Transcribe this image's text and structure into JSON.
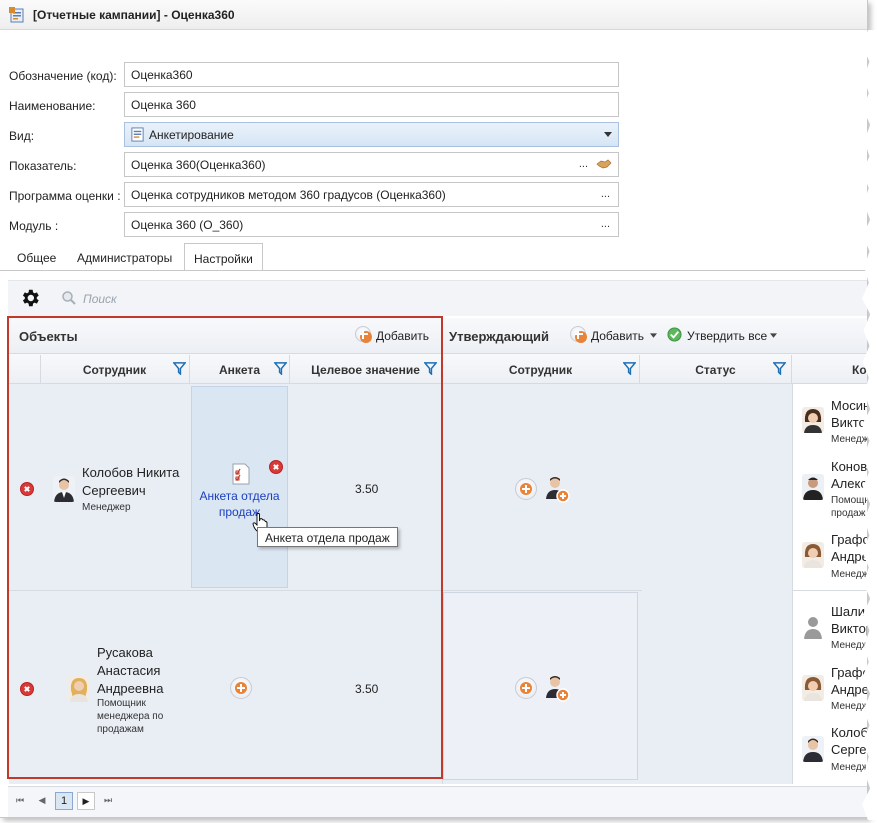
{
  "window": {
    "title": "[Отчетные кампании] - Оценка360"
  },
  "form": {
    "code_label": "Обозначение (код):",
    "code_value": "Оценка360",
    "name_label": "Наименование:",
    "name_value": "Оценка 360",
    "type_label": "Вид:",
    "type_value": "Анкетирование",
    "indicator_label": "Показатель:",
    "indicator_value": "Оценка 360(Оценка360)",
    "program_label": "Программа оценки :",
    "program_value": "Оценка сотрудников методом 360 градусов (Оценка360)",
    "module_label": "Модуль :",
    "module_value": "Оценка 360 (О_360)",
    "dots": "..."
  },
  "tabs": [
    {
      "label": "Общее"
    },
    {
      "label": "Администраторы"
    },
    {
      "label": "Настройки"
    }
  ],
  "toolbar": {
    "search_placeholder": "Поиск"
  },
  "objects": {
    "title": "Объекты",
    "add_label": "Добавить",
    "columns": [
      "Сотрудник",
      "Анкета",
      "Целевое значение"
    ]
  },
  "approver": {
    "title": "Утверждающий",
    "add_label": "Добавить",
    "approve_all_label": "Утвердить все",
    "columns": [
      "Сотрудник",
      "Статус"
    ]
  },
  "right_header": "Ко",
  "rows": [
    {
      "name": "Колобов Никита Сергеевич",
      "role": "Менеджер",
      "survey": "Анкета отдела продаж",
      "target": "3.50"
    },
    {
      "name": "Русакова Анастасия Андреевна",
      "role": "Помощник менеджера по продажам",
      "target": "3.50"
    }
  ],
  "tooltip": "Анкета отдела продаж",
  "right_people": [
    {
      "l1": "Мосин",
      "l2": "Виктор",
      "role": "Менедж"
    },
    {
      "l1": "Конов",
      "l2": "Алекса",
      "role": "Помощн",
      "role2": "продаж"
    },
    {
      "l1": "Графо",
      "l2": "Андре",
      "role": "Менедж"
    },
    {
      "l1": "Шалин",
      "l2": "Виктор",
      "role": "Менедж"
    },
    {
      "l1": "Графо",
      "l2": "Андре",
      "role": "Менедж"
    },
    {
      "l1": "Колоб",
      "l2": "Серге",
      "role": "Менедж"
    }
  ],
  "pager": {
    "page": "1"
  },
  "colors": {
    "accent_orange": "#e8833a",
    "remove_red": "#d83a3a",
    "frame_red": "#c0392b",
    "link_blue": "#1a3fc0"
  }
}
